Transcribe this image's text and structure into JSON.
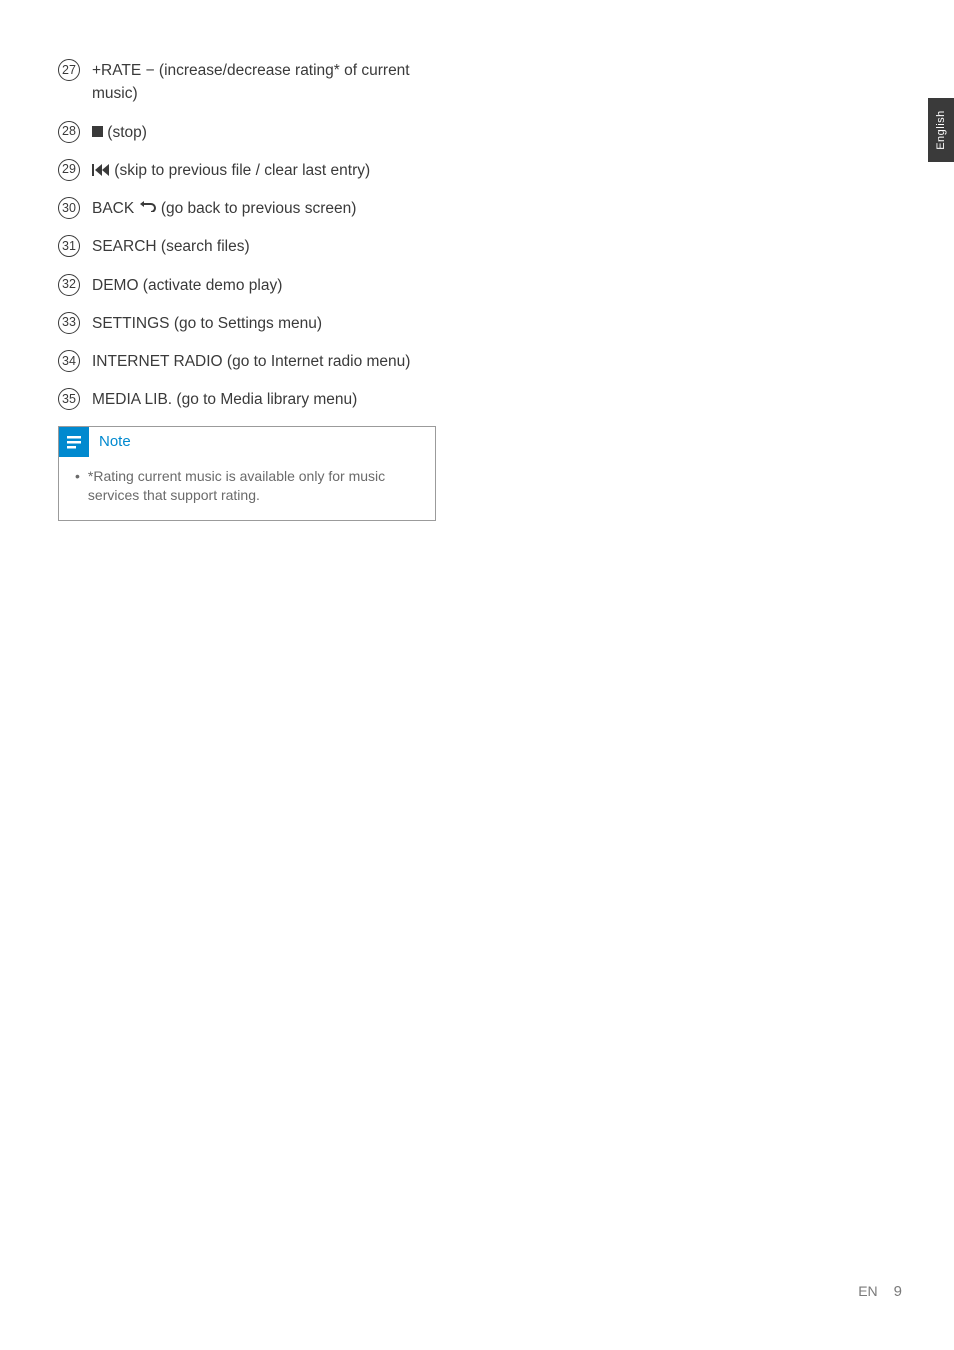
{
  "items": [
    {
      "num": "27",
      "text": "+RATE − (increase/decrease rating* of current music)",
      "icon": null
    },
    {
      "num": "28",
      "text": " (stop)",
      "icon": "stop"
    },
    {
      "num": "29",
      "text": " (skip to previous file / clear last entry)",
      "icon": "skip-prev"
    },
    {
      "num": "30",
      "text": " (go back to previous screen)",
      "icon": "back",
      "prefix": "BACK "
    },
    {
      "num": "31",
      "text": "SEARCH (search files)",
      "icon": null
    },
    {
      "num": "32",
      "text": "DEMO (activate demo play)",
      "icon": null
    },
    {
      "num": "33",
      "text": "SETTINGS (go to Settings menu)",
      "icon": null
    },
    {
      "num": "34",
      "text": "INTERNET RADIO (go to Internet radio menu)",
      "icon": null
    },
    {
      "num": "35",
      "text": "MEDIA LIB. (go to Media library menu)",
      "icon": null
    }
  ],
  "note": {
    "title": "Note",
    "body": "*Rating current music is available only for music services that support rating."
  },
  "sideTab": "English",
  "footer": {
    "lang": "EN",
    "page": "9"
  }
}
